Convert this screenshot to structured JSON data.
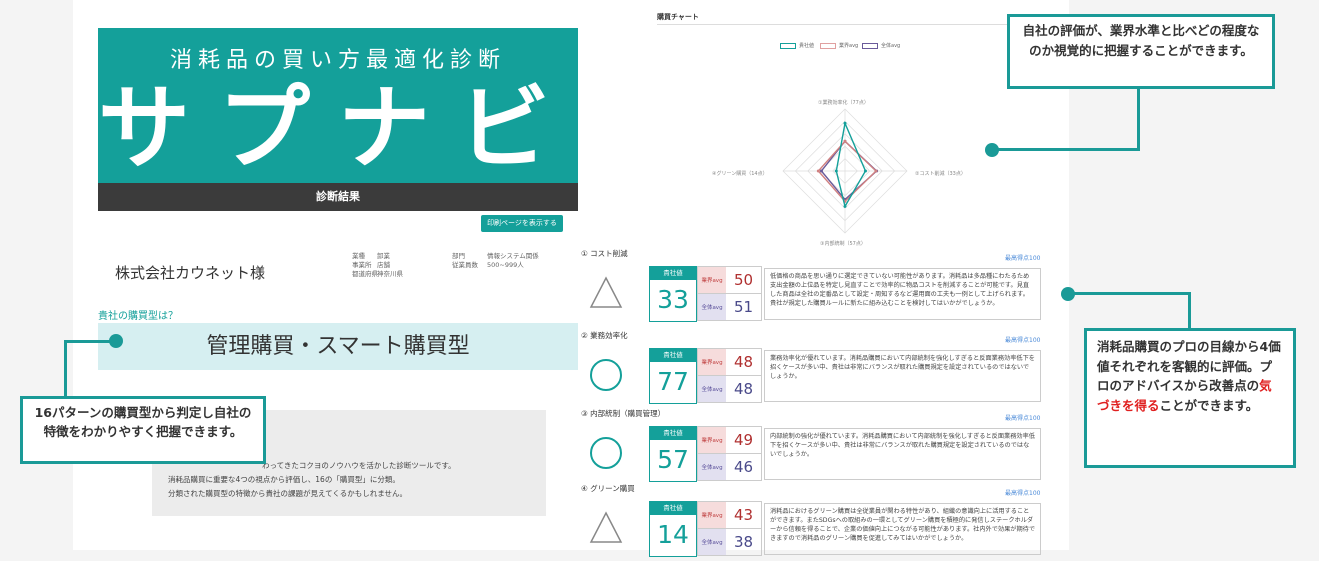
{
  "hero": {
    "subtitle": "消耗品の買い方最適化診断",
    "title": "サプナビ"
  },
  "result_bar": {
    "label": "診断結果"
  },
  "print_button": {
    "label": "印刷ページを表示する"
  },
  "company": {
    "name": "株式会社カウネット様",
    "industry_label": "業種",
    "industry_value": "卸業",
    "office_label": "事業所",
    "office_value": "店舗",
    "pref_label": "都道府県",
    "pref_value": "神奈川県",
    "dept_label": "部門",
    "dept_value": "情報システム関係",
    "staff_label": "従業員数",
    "staff_value": "500~999人"
  },
  "purchase_type": {
    "question": "貴社の購買型は？",
    "value": "管理購買・スマート購買型"
  },
  "description": {
    "line1": "わってきたコクヨのノウハウを活かした診断ツールです。",
    "line2": "消耗品購買に重要な4つの視点から評価し、16の「購買型」に分類。",
    "line3": "分類された購買型の特徴から貴社の課題が見えてくるかもしれません。"
  },
  "chart": {
    "title": "購買チャート",
    "legend": [
      "貴社値",
      "業界avg",
      "全体avg"
    ],
    "axis_labels": [
      "①業務効率化（77点）",
      "②コスト削減（33点）",
      "③内部統制（57点）",
      "④グリーン購買（14点）"
    ]
  },
  "chart_data": {
    "type": "radar",
    "categories": [
      "業務効率化",
      "コスト削減",
      "内部統制",
      "グリーン購買"
    ],
    "series": [
      {
        "name": "貴社値",
        "values": [
          77,
          33,
          57,
          14
        ]
      },
      {
        "name": "業界avg",
        "values": [
          48,
          50,
          49,
          43
        ]
      },
      {
        "name": "全体avg",
        "values": [
          48,
          51,
          46,
          38
        ]
      }
    ],
    "ylim": [
      0,
      100
    ],
    "colors": {
      "our": "#14a09a",
      "industry": "#d08080",
      "overall": "#6a5a9a"
    }
  },
  "sections": [
    {
      "header": "① コスト削減",
      "max": "最高得点100",
      "mark": "triangle",
      "our_label": "貴社値",
      "our": "33",
      "ind_label": "業界avg",
      "ind": "50",
      "all_label": "全体avg",
      "all": "51",
      "comment": "低価格の商品を思い通りに選定できていない可能性があります。消耗品は多品種にわたるため支出金額の上位品を特定し見直すことで効率的に物品コストを削減することが可能です。見直した商品は全社の定番品として設定・周知するなど運用面の工夫も一例として上げられます。貴社が規定した購買ルールに新たに組み込むことを検討してはいかがでしょうか。"
    },
    {
      "header": "② 業務効率化",
      "max": "最高得点100",
      "mark": "circle",
      "our_label": "貴社値",
      "our": "77",
      "ind_label": "業界avg",
      "ind": "48",
      "all_label": "全体avg",
      "all": "48",
      "comment": "業務効率化が優れています。消耗品購買において内部統制を強化しすぎると反面業務効率低下を招くケースが多い中、貴社は非常にバランスが取れた購買規定を設定されているのではないでしょうか。"
    },
    {
      "header": "③ 内部統制（購買管理）",
      "max": "最高得点100",
      "mark": "circle",
      "our_label": "貴社値",
      "our": "57",
      "ind_label": "業界avg",
      "ind": "49",
      "all_label": "全体avg",
      "all": "46",
      "comment": "内部統制の強化が優れています。消耗品購買において内部統制を強化しすぎると反面業務効率低下を招くケースが多い中、貴社は非常にバランスが取れた購買規定を設定されているのではないでしょうか。"
    },
    {
      "header": "④ グリーン購買",
      "max": "最高得点100",
      "mark": "triangle",
      "our_label": "貴社値",
      "our": "14",
      "ind_label": "業界avg",
      "ind": "43",
      "all_label": "全体avg",
      "all": "38",
      "comment": "消耗品におけるグリーン購買は全従業員が関わる特性があり、組織の意識向上に活用することができます。またSDGsへの取組みの一環としてグリーン購買を積極的に発信しステークホルダーから信頼を得ることで、企業の価値向上につながる可能性があります。社内外で効果が期待できますので消耗品のグリーン購買を促進してみてはいかがでしょうか。"
    }
  ],
  "callouts": {
    "chart": "自社の評価が、業界水準と比べどの程度なのか視覚的に把握することができます。",
    "type": "16パターンの購買型から判定し自社の特徴をわかりやすく把握できます。",
    "pro_1": "消耗品購買のプロの目線から4価値それぞれを客観的に評価。プロのアドバイスから改善点の",
    "pro_highlight": "気づきを得る",
    "pro_2": "ことができます。"
  }
}
